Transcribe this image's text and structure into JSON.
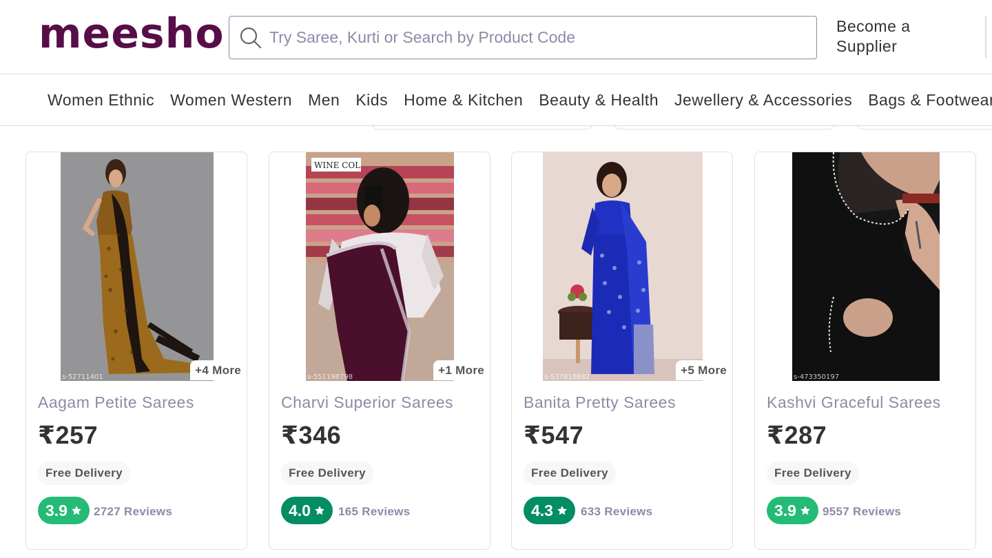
{
  "header": {
    "logo": "meesho",
    "search_placeholder": "Try Saree, Kurti or Search by Product Code",
    "supplier_line1": "Become a",
    "supplier_line2": "Supplier"
  },
  "nav": [
    "Women Ethnic",
    "Women Western",
    "Men",
    "Kids",
    "Home & Kitchen",
    "Beauty & Health",
    "Jewellery & Accessories",
    "Bags & Footwear"
  ],
  "products": [
    {
      "name": "Aagam Petite Sarees",
      "price": "₹257",
      "delivery": "Free Delivery",
      "rating": "3.9",
      "reviews": "2727 Reviews",
      "more": "+4 More",
      "code": "s-52711401",
      "rating_color": "#23bb75"
    },
    {
      "name": "Charvi Superior Sarees",
      "price": "₹346",
      "delivery": "Free Delivery",
      "rating": "4.0",
      "reviews": "165 Reviews",
      "more": "+1 More",
      "code": "s-551198798",
      "rating_color": "#038d63",
      "tag": "WINE COL"
    },
    {
      "name": "Banita Pretty Sarees",
      "price": "₹547",
      "delivery": "Free Delivery",
      "rating": "4.3",
      "reviews": "633 Reviews",
      "more": "+5 More",
      "code": "s-537818882",
      "rating_color": "#038d63"
    },
    {
      "name": "Kashvi Graceful Sarees",
      "price": "₹287",
      "delivery": "Free Delivery",
      "rating": "3.9",
      "reviews": "9557 Reviews",
      "code": "s-473350197",
      "rating_color": "#23bb75"
    }
  ],
  "colors": {
    "brand": "#570d48",
    "muted_text": "#8b8ba7",
    "rating_light": "#23bb75",
    "rating_dark": "#038d63"
  }
}
